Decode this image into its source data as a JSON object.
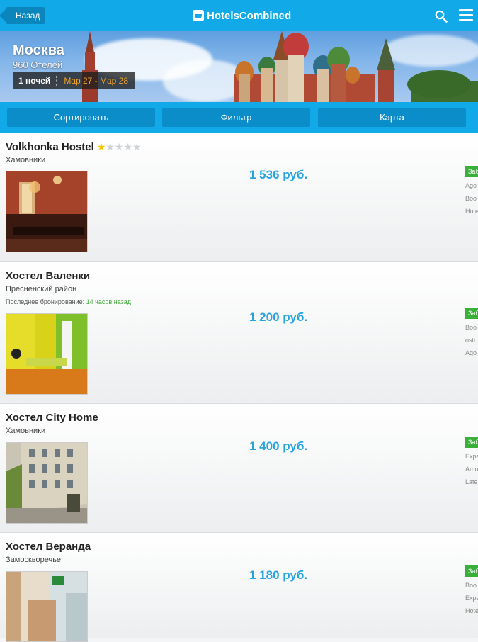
{
  "header": {
    "back_label": "Назад",
    "logo_bold": "Hotels",
    "logo_rest": "Combined"
  },
  "hero": {
    "city": "Москва",
    "count": "960 Отелей",
    "nights": "1 ночей",
    "dates": "Map 27 - Map 28"
  },
  "actions": {
    "sort": "Сортировать",
    "filter": "Фильтр",
    "map": "Карта"
  },
  "hotels": [
    {
      "name": "Volkhonka Hostel",
      "stars": 1,
      "district": "Хамовники",
      "booked_prefix": "",
      "booked_time": "",
      "price": "1 536 руб.",
      "badge": "Заб",
      "providers": [
        "Ago",
        "Boo",
        "Hote"
      ]
    },
    {
      "name": "Хостел Валенки",
      "stars": 0,
      "district": "Пресненский район",
      "booked_prefix": "Последнее бронирование: ",
      "booked_time": "14 часов назад",
      "price": "1 200 руб.",
      "badge": "Заб",
      "providers": [
        "Boo",
        "ostr",
        "Ago"
      ]
    },
    {
      "name": "Хостел City Home",
      "stars": 0,
      "district": "Хамовники",
      "booked_prefix": "",
      "booked_time": "",
      "price": "1 400 руб.",
      "badge": "Заб",
      "providers": [
        "Expe",
        "Amo",
        "Late"
      ]
    },
    {
      "name": "Хостел Веранда",
      "stars": 0,
      "district": "Замоскворечье",
      "booked_prefix": "",
      "booked_time": "",
      "price": "1 180 руб.",
      "badge": "Заб",
      "providers": [
        "Boo",
        "Expe",
        "Hote"
      ]
    }
  ],
  "colors": {
    "brand": "#12a9e8",
    "price": "#27a3de",
    "badge": "#3aaf3a",
    "dates": "#f5a623"
  }
}
